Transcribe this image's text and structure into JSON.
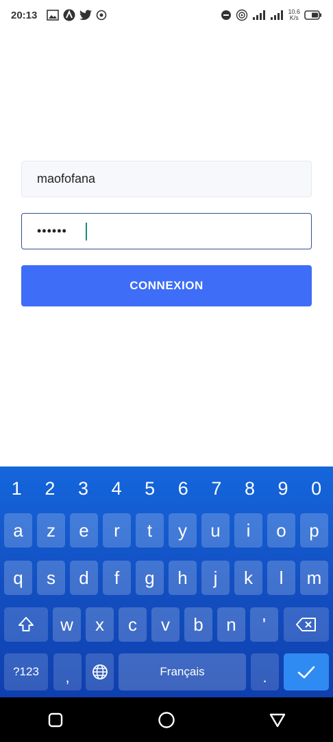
{
  "status_bar": {
    "time": "20:13",
    "net_speed_value": "10.6",
    "net_speed_unit": "K/s",
    "icons_left": [
      "image-icon",
      "app-a-icon",
      "twitter-icon",
      "signal-app-icon"
    ],
    "icons_right": [
      "dnd-icon",
      "hotspot-icon",
      "signal-icon",
      "signal-icon-2",
      "battery-icon"
    ]
  },
  "login": {
    "username_value": "maofofana",
    "password_value": "••••••",
    "submit_label": "CONNEXION"
  },
  "keyboard": {
    "numbers": [
      "1",
      "2",
      "3",
      "4",
      "5",
      "6",
      "7",
      "8",
      "9",
      "0"
    ],
    "row1": [
      "a",
      "z",
      "e",
      "r",
      "t",
      "y",
      "u",
      "i",
      "o",
      "p"
    ],
    "row2": [
      "q",
      "s",
      "d",
      "f",
      "g",
      "h",
      "j",
      "k",
      "l",
      "m"
    ],
    "row3": [
      "w",
      "x",
      "c",
      "v",
      "b",
      "n",
      "'"
    ],
    "symbols_label": "?123",
    "comma_label": ",",
    "space_label": "Français",
    "period_label": "."
  },
  "colors": {
    "primary": "#3e6df7",
    "keyboard_bg": "#1566dc",
    "enter_key": "#2f8bf2"
  }
}
